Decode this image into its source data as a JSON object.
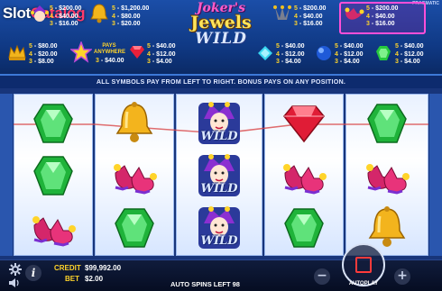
{
  "watermark": {
    "brand_part1": "Slot",
    "brand_part2": "Catalog"
  },
  "header": {
    "title_line1": "Joker's",
    "title_line2": "Jewels",
    "title_line3": "WILD",
    "provider": "PRAGMATIC"
  },
  "paytable": {
    "joker": [
      {
        "n": "5",
        "v": "$200.00"
      },
      {
        "n": "4",
        "v": "$40.00"
      },
      {
        "n": "3",
        "v": "$16.00"
      }
    ],
    "bell": [
      {
        "n": "5",
        "v": "$1,200.00"
      },
      {
        "n": "4",
        "v": "$80.00"
      },
      {
        "n": "3",
        "v": "$20.00"
      }
    ],
    "clover": [
      {
        "n": "5",
        "v": "$200.00"
      },
      {
        "n": "4",
        "v": "$40.00"
      },
      {
        "n": "3",
        "v": "$16.00"
      }
    ],
    "wild": [
      {
        "n": "5",
        "v": "$200.00"
      },
      {
        "n": "4",
        "v": "$40.00"
      },
      {
        "n": "3",
        "v": "$16.00"
      }
    ],
    "crown": [
      {
        "n": "5",
        "v": "$80.00"
      },
      {
        "n": "4",
        "v": "$20.00"
      },
      {
        "n": "3",
        "v": "$8.00"
      }
    ],
    "star": {
      "label": "PAYS ANYWHERE",
      "n": "3",
      "v": "$40.00"
    },
    "red_gem": [
      {
        "n": "5",
        "v": "$40.00"
      },
      {
        "n": "4",
        "v": "$12.00"
      },
      {
        "n": "3",
        "v": "$4.00"
      }
    ],
    "blue_gem": [
      {
        "n": "5",
        "v": "$40.00"
      },
      {
        "n": "4",
        "v": "$12.00"
      },
      {
        "n": "3",
        "v": "$4.00"
      }
    ],
    "purple_gem": [
      {
        "n": "5",
        "v": "$40.00"
      },
      {
        "n": "4",
        "v": "$12.00"
      },
      {
        "n": "3",
        "v": "$4.00"
      }
    ],
    "green_gem": [
      {
        "n": "5",
        "v": "$40.00"
      },
      {
        "n": "4",
        "v": "$12.00"
      },
      {
        "n": "3",
        "v": "$4.00"
      }
    ]
  },
  "rules_text": "ALL SYMBOLS PAY FROM LEFT TO RIGHT. BONUS PAYS ON ANY POSITION.",
  "reels": [
    [
      "green-gem",
      "green-gem",
      "jester-shoes"
    ],
    [
      "gold-bell",
      "jester-shoes",
      "green-gem"
    ],
    [
      "joker-wild",
      "joker-wild",
      "joker-wild"
    ],
    [
      "red-gem",
      "jester-shoes",
      "green-gem"
    ],
    [
      "green-gem",
      "jester-shoes",
      "gold-bell"
    ]
  ],
  "wild_label": "WILD",
  "bottom": {
    "credit_label": "CREDIT",
    "credit_value": "$99,992.00",
    "bet_label": "BET",
    "bet_value": "$2.00",
    "auto_spins": "AUTO SPINS LEFT 98",
    "autoplay_label": "AUTOPLAY",
    "minus": "−",
    "plus": "+"
  },
  "colors": {
    "accent_yellow": "#ffd42a",
    "header_blue": "#1b4ea8",
    "stop_red": "#ff3b3b"
  }
}
